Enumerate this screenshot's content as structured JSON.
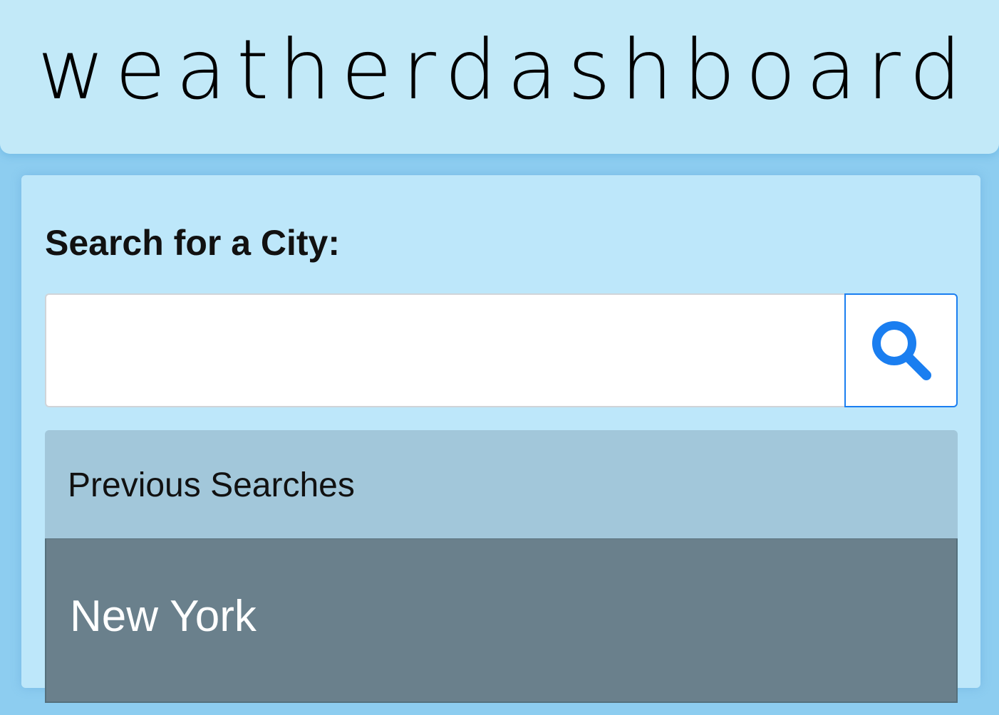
{
  "header": {
    "title": "weatherdashboard"
  },
  "search": {
    "label": "Search for a City:",
    "input_value": "",
    "placeholder": "",
    "button_icon": "search-icon"
  },
  "history": {
    "title": "Previous Searches",
    "items": [
      {
        "label": "New York"
      }
    ]
  },
  "colors": {
    "page_background": "#8dcdf0",
    "header_background": "#c2e9f8",
    "card_background": "#bde7fa",
    "history_header_background": "#a2c7da",
    "history_item_background": "#6a808c",
    "accent": "#1a7ef0"
  }
}
